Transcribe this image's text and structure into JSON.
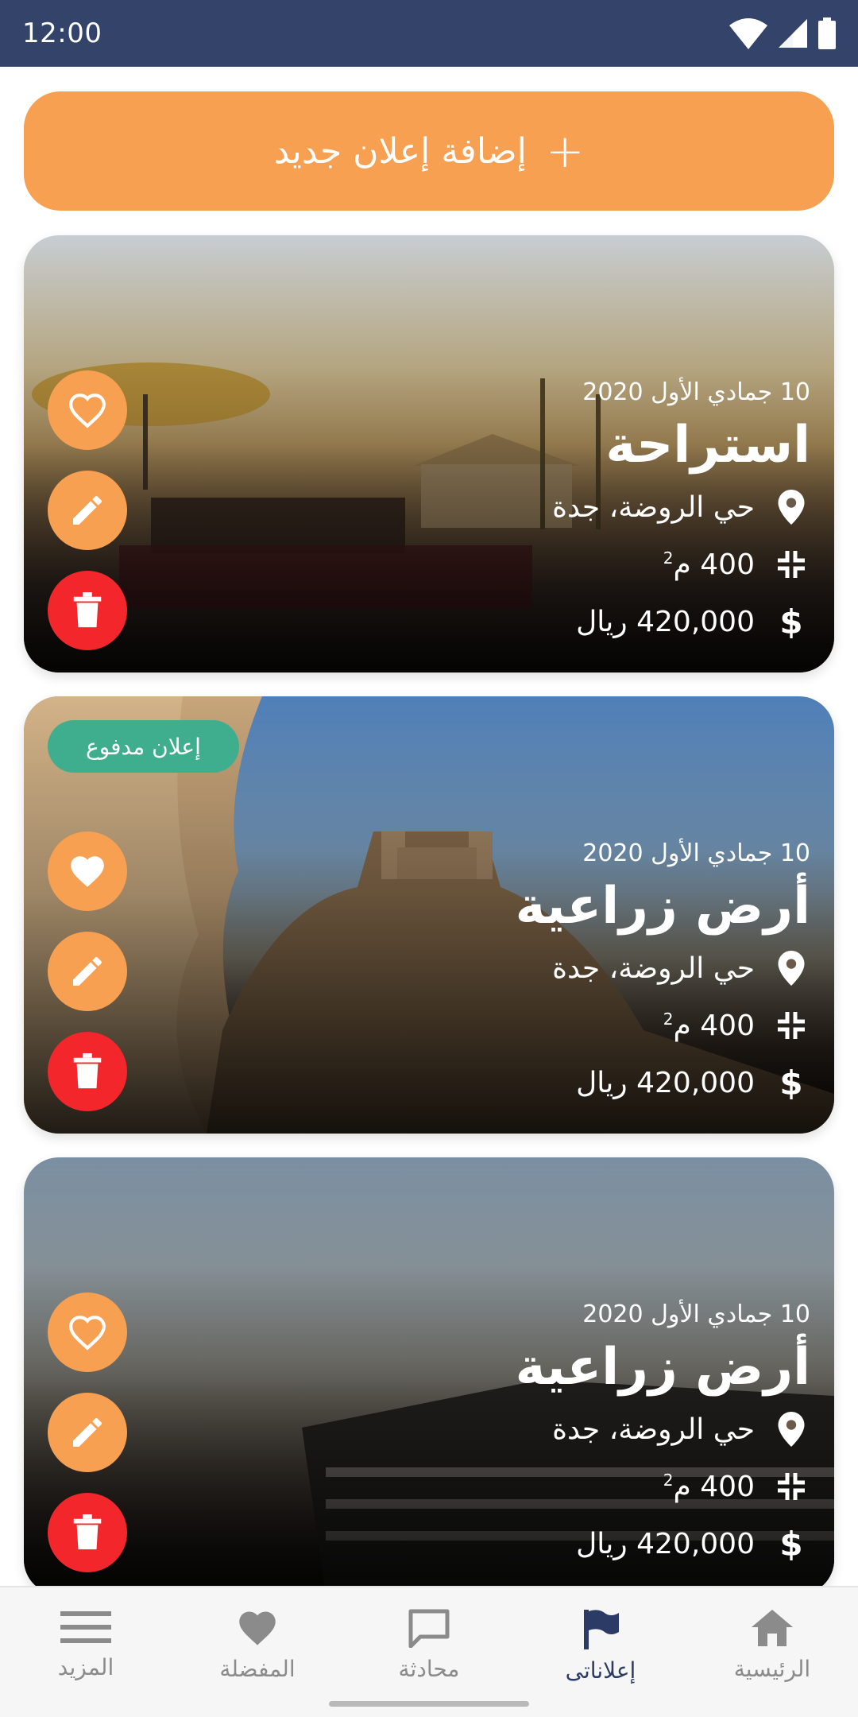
{
  "status": {
    "time": "12:00"
  },
  "add_button": {
    "label": "إضافة إعلان جديد",
    "plus": "+"
  },
  "listings": [
    {
      "date": "10 جمادي الأول 2020",
      "title": "استراحة",
      "location": "حي الروضة، جدة",
      "area_value": "400",
      "area_unit": "م",
      "area_sup": "2",
      "price": "420,000 ريال",
      "badge": "",
      "favorited": false
    },
    {
      "date": "10 جمادي الأول 2020",
      "title": "أرض زراعية",
      "location": "حي الروضة، جدة",
      "area_value": "400",
      "area_unit": "م",
      "area_sup": "2",
      "price": "420,000 ريال",
      "badge": "إعلان مدفوع",
      "favorited": true
    },
    {
      "date": "10 جمادي الأول 2020",
      "title": "أرض زراعية",
      "location": "حي الروضة، جدة",
      "area_value": "400",
      "area_unit": "م",
      "area_sup": "2",
      "price": "420,000 ريال",
      "badge": "",
      "favorited": false
    }
  ],
  "nav": [
    {
      "label": "المزيد",
      "icon": "menu-icon",
      "active": false
    },
    {
      "label": "المفضلة",
      "icon": "heart-icon",
      "active": false
    },
    {
      "label": "محادثة",
      "icon": "chat-icon",
      "active": false
    },
    {
      "label": "إعلاناتى",
      "icon": "flag-icon",
      "active": true
    },
    {
      "label": "الرئيسية",
      "icon": "home-icon",
      "active": false
    }
  ],
  "colors": {
    "status_bar": "#34436a",
    "accent_orange": "#f7a052",
    "delete_red": "#f2262b",
    "badge_green": "#3fae8e",
    "nav_active": "#2c3a66"
  }
}
